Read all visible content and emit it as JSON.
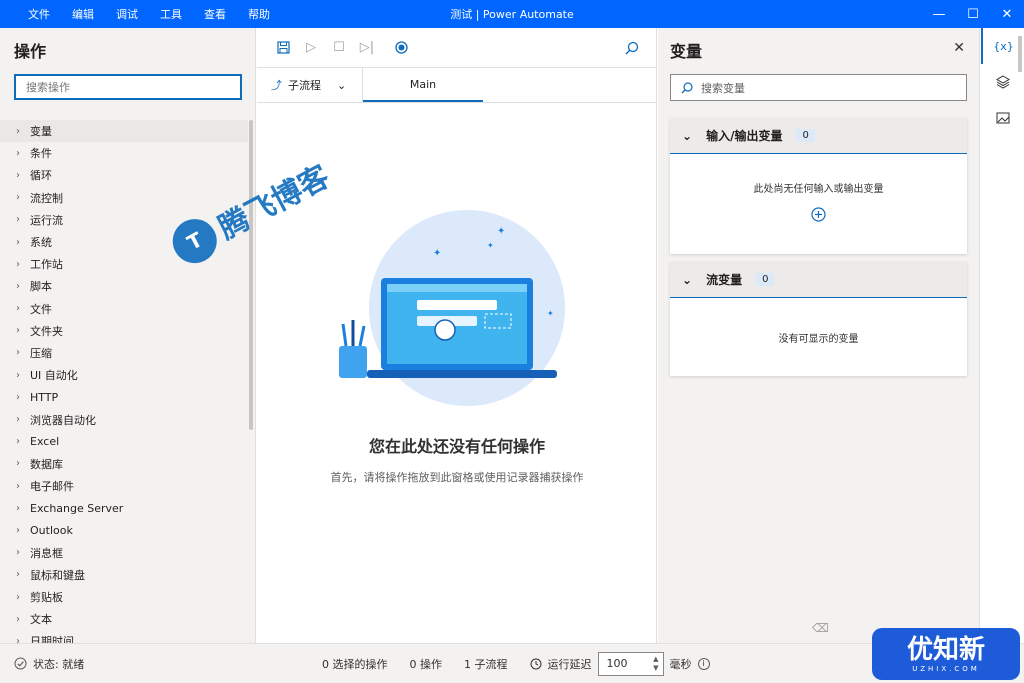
{
  "titlebar": {
    "menu": [
      "文件",
      "编辑",
      "调试",
      "工具",
      "查看",
      "帮助"
    ],
    "title": "测试 | Power Automate",
    "minimize": "—",
    "maximize": "☐",
    "close": "✕"
  },
  "actions": {
    "heading": "操作",
    "search_placeholder": "搜索操作",
    "categories": [
      "变量",
      "条件",
      "循环",
      "流控制",
      "运行流",
      "系统",
      "工作站",
      "脚本",
      "文件",
      "文件夹",
      "压缩",
      "UI 自动化",
      "HTTP",
      "浏览器自动化",
      "Excel",
      "数据库",
      "电子邮件",
      "Exchange Server",
      "Outlook",
      "消息框",
      "鼠标和键盘",
      "剪贴板",
      "文本",
      "日期时间"
    ]
  },
  "designer": {
    "subflow_label": "子流程",
    "main_tab": "Main",
    "empty_title": "您在此处还没有任何操作",
    "empty_desc": "首先，请将操作拖放到此窗格或使用记录器捕获操作"
  },
  "variables": {
    "heading": "变量",
    "search_placeholder": "搜索变量",
    "io_section": {
      "title": "输入/输出变量",
      "count": "0",
      "empty_text": "此处尚无任何输入或输出变量"
    },
    "flow_section": {
      "title": "流变量",
      "count": "0",
      "empty_text": "没有可显示的变量"
    }
  },
  "rail": {
    "vars_label": "{x}"
  },
  "status": {
    "state": "状态: 就绪",
    "selected": "0 选择的操作",
    "actions": "0 操作",
    "subflows": "1 子流程",
    "delay_label": "运行延迟",
    "delay_value": "100",
    "unit": "毫秒"
  },
  "watermarks": {
    "blog": "腾飞博客",
    "brand": "优知新",
    "domain": "UZHIX.COM"
  },
  "colors": {
    "titlebar": "#0066ff",
    "accent": "#0f6cbd"
  }
}
